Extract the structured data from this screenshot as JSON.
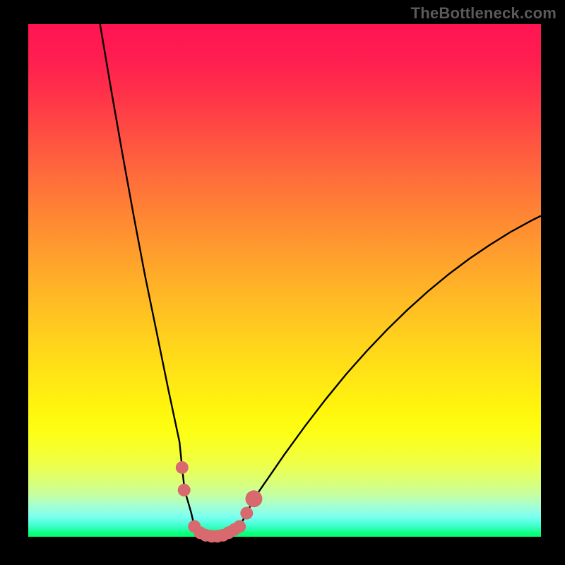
{
  "watermark": "TheBottleneck.com",
  "colors": {
    "dot": "#d86a6f",
    "curve": "#000000",
    "frame": "#000000"
  },
  "chart_data": {
    "type": "line",
    "title": "",
    "xlabel": "",
    "ylabel": "",
    "xlim": [
      0,
      100
    ],
    "ylim": [
      0,
      100
    ],
    "grid": false,
    "legend": false,
    "series": [
      {
        "name": "left-branch",
        "x": [
          14.0,
          16.2,
          18.4,
          20.6,
          22.8,
          25.1,
          27.3,
          29.5,
          30.0,
          30.5,
          31.8,
          32.4
        ],
        "y": [
          100.0,
          87.0,
          74.5,
          62.4,
          50.8,
          39.6,
          28.8,
          18.5,
          13.5,
          9.1,
          4.6,
          2.0
        ]
      },
      {
        "name": "floor",
        "x": [
          32.4,
          33.5,
          34.6,
          35.8,
          36.9,
          38.0,
          39.1,
          40.2,
          41.2
        ],
        "y": [
          2.0,
          0.8,
          0.3,
          0.1,
          0.1,
          0.3,
          0.8,
          1.4,
          2.0
        ]
      },
      {
        "name": "right-branch",
        "x": [
          41.2,
          42.6,
          44.0,
          46.0,
          48.0,
          50.0,
          54.0,
          58.0,
          62.0,
          66.0,
          70.0,
          74.0,
          78.0,
          82.0,
          86.0,
          90.0,
          94.0,
          98.0,
          100.0
        ],
        "y": [
          2.0,
          4.6,
          7.4,
          10.3,
          13.2,
          16.1,
          21.6,
          26.8,
          31.7,
          36.2,
          40.4,
          44.3,
          47.9,
          51.2,
          54.2,
          56.9,
          59.4,
          61.6,
          62.6
        ]
      }
    ],
    "scatter": [
      {
        "name": "dots",
        "x": [
          30.0,
          30.4,
          32.4,
          33.5,
          34.6,
          35.8,
          36.9,
          38.0,
          39.1,
          40.2,
          41.2,
          42.6,
          44.0
        ],
        "y": [
          13.5,
          9.1,
          2.0,
          0.8,
          0.3,
          0.1,
          0.1,
          0.3,
          0.8,
          1.4,
          2.0,
          4.6,
          7.4
        ],
        "r": [
          9,
          9,
          9,
          9,
          9,
          9,
          9,
          9,
          9,
          9,
          9,
          9,
          12
        ]
      }
    ]
  }
}
